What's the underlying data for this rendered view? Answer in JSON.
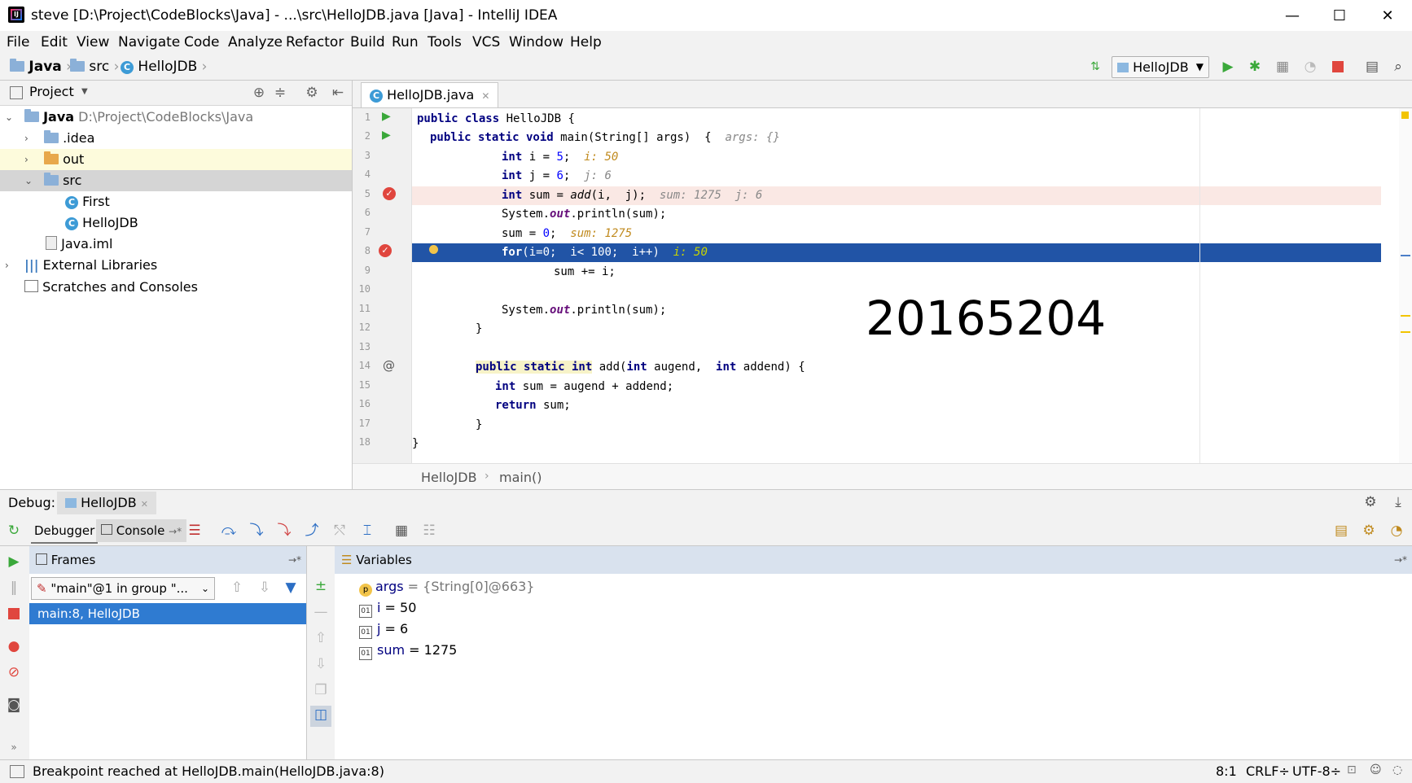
{
  "window": {
    "title": "steve [D:\\Project\\CodeBlocks\\Java] - ...\\src\\HelloJDB.java [Java] - IntelliJ IDEA",
    "minimize": "—",
    "maximize": "☐",
    "close": "✕"
  },
  "menu": [
    "File",
    "Edit",
    "View",
    "Navigate",
    "Code",
    "Analyze",
    "Refactor",
    "Build",
    "Run",
    "Tools",
    "VCS",
    "Window",
    "Help"
  ],
  "breadcrumb": [
    "Java",
    "src",
    "HelloJDB"
  ],
  "run_config": "HelloJDB",
  "project": {
    "header": "Project",
    "tree": [
      {
        "label": "Java",
        "path": "D:\\Project\\CodeBlocks\\Java"
      },
      {
        "label": ".idea"
      },
      {
        "label": "out"
      },
      {
        "label": "src"
      },
      {
        "label": "First"
      },
      {
        "label": "HelloJDB"
      },
      {
        "label": "Java.iml"
      },
      {
        "label": "External Libraries"
      },
      {
        "label": "Scratches and Consoles"
      }
    ]
  },
  "editor": {
    "tab": "HelloJDB.java",
    "line_numbers": [
      "1",
      "2",
      "3",
      "4",
      "5",
      "6",
      "7",
      "8",
      "9",
      "10",
      "11",
      "12",
      "13",
      "14",
      "15",
      "16",
      "17",
      "18"
    ],
    "overlay_text": "20165204",
    "bottom_crumb": [
      "HelloJDB",
      "main()"
    ],
    "code": {
      "l1": {
        "a": "public class",
        "b": " HelloJDB {"
      },
      "l2": {
        "a": "public static void",
        "b": " main(String[] args)  {",
        "hint": "  args: {}"
      },
      "l3": {
        "a": "int",
        "b": " i = ",
        "n": "5",
        "c": ";",
        "hint": "  i: 50"
      },
      "l4": {
        "a": "int",
        "b": " j = ",
        "n": "6",
        "c": ";",
        "hint": "  j: 6"
      },
      "l5": {
        "a": "int",
        "b": " sum = ",
        "i": "add",
        "c": "(i,  j);",
        "hint": "  sum: 1275  j: 6"
      },
      "l6": {
        "b": "System.",
        "f": "out",
        "c": ".println(sum);"
      },
      "l7": {
        "b": "sum = ",
        "n": "0",
        "c": ";",
        "hint": "  sum: 1275"
      },
      "l8": {
        "a": "for",
        "b": "(i=0;  i< 100;  i++)",
        "hint": "  i: 50"
      },
      "l9": {
        "b": "sum += i;"
      },
      "l11": {
        "b": "System.",
        "f": "out",
        "c": ".println(sum);"
      },
      "l12": {
        "b": "}"
      },
      "l14": {
        "a": "public static int",
        "b": " add(",
        "a2": "int",
        "b2": " augend,  ",
        "a3": "int",
        "b3": " addend) {"
      },
      "l15": {
        "a": "int",
        "b": " sum = augend + addend;"
      },
      "l16": {
        "a": "return",
        "b": " sum;"
      },
      "l17": {
        "b": "}"
      },
      "l18": {
        "b": "}"
      }
    }
  },
  "debug": {
    "label": "Debug:",
    "session_tab": "HelloJDB",
    "debugger_tab": "Debugger",
    "console_tab": "Console",
    "frames_header": "Frames",
    "thread": "\"main\"@1 in group \"...",
    "frame": "main:8, HelloJDB",
    "variables_header": "Variables",
    "variables": [
      {
        "icon": "p",
        "name": "args",
        "value": " = {String[0]@663}"
      },
      {
        "icon": "01",
        "name": "i",
        "value": " = 50"
      },
      {
        "icon": "01",
        "name": "j",
        "value": " = 6"
      },
      {
        "icon": "01",
        "name": "sum",
        "value": " = 1275"
      }
    ]
  },
  "status": {
    "message": "Breakpoint reached at HelloJDB.main(HelloJDB.java:8)",
    "position": "8:1",
    "line_sep": "CRLF÷",
    "encoding": "UTF-8÷"
  },
  "colors": {
    "current_line": "#2154a6",
    "breakpoint_line": "#fae8e4",
    "keyword": "#000080",
    "run_green": "#3aa83a",
    "stop_red": "#e0463e"
  }
}
